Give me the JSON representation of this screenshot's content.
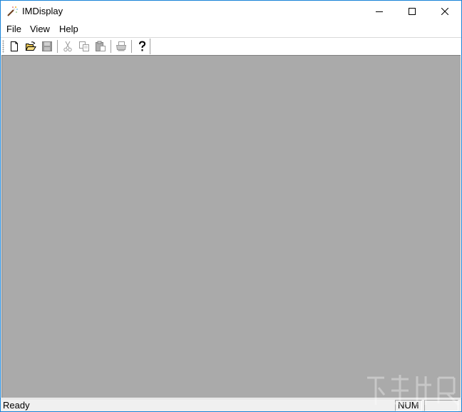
{
  "window": {
    "title": "IMDisplay"
  },
  "menu": {
    "file": "File",
    "view": "View",
    "help": "Help"
  },
  "toolbar": {
    "buttons": [
      {
        "icon": "new-document-icon",
        "enabled": true
      },
      {
        "icon": "open-folder-icon",
        "enabled": true
      },
      {
        "icon": "save-icon",
        "enabled": false
      },
      {
        "icon": "cut-icon",
        "enabled": false
      },
      {
        "icon": "copy-icon",
        "enabled": false
      },
      {
        "icon": "paste-icon",
        "enabled": false
      },
      {
        "icon": "print-icon",
        "enabled": false
      },
      {
        "icon": "help-icon",
        "enabled": true
      }
    ]
  },
  "client": {
    "background": "#aaaaaa"
  },
  "status": {
    "text": "Ready",
    "num": "NUM"
  },
  "colors": {
    "accent_border": "#1883d7"
  }
}
